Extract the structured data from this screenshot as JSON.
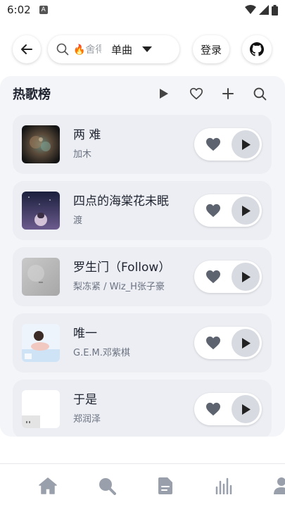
{
  "status_bar": {
    "time": "6:02",
    "notif_badge": "A"
  },
  "topbar": {
    "search_placeholder": "🔥舍得",
    "search_type": "单曲",
    "login_label": "登录"
  },
  "playlist": {
    "title": "热歌榜",
    "songs": [
      {
        "title": "两 难",
        "artist": "加木"
      },
      {
        "title": "四点的海棠花未眠",
        "artist": "渡"
      },
      {
        "title": "罗生门（Follow）",
        "artist": "梨冻紧 / Wiz_H张子豪"
      },
      {
        "title": "唯一",
        "artist": "G.E.M.邓紫棋"
      },
      {
        "title": "于是",
        "artist": "郑润泽"
      }
    ]
  },
  "colors": {
    "accent": "#343a46",
    "card_bg": "#f4f5f8",
    "item_bg": "#eceef3"
  },
  "icons": [
    "back-icon",
    "search-icon",
    "chevron-down-icon",
    "github-icon",
    "play-icon",
    "heart-outline-icon",
    "plus-icon",
    "heart-icon",
    "home-icon",
    "explore-icon",
    "document-icon",
    "chart-icon",
    "profile-icon"
  ]
}
